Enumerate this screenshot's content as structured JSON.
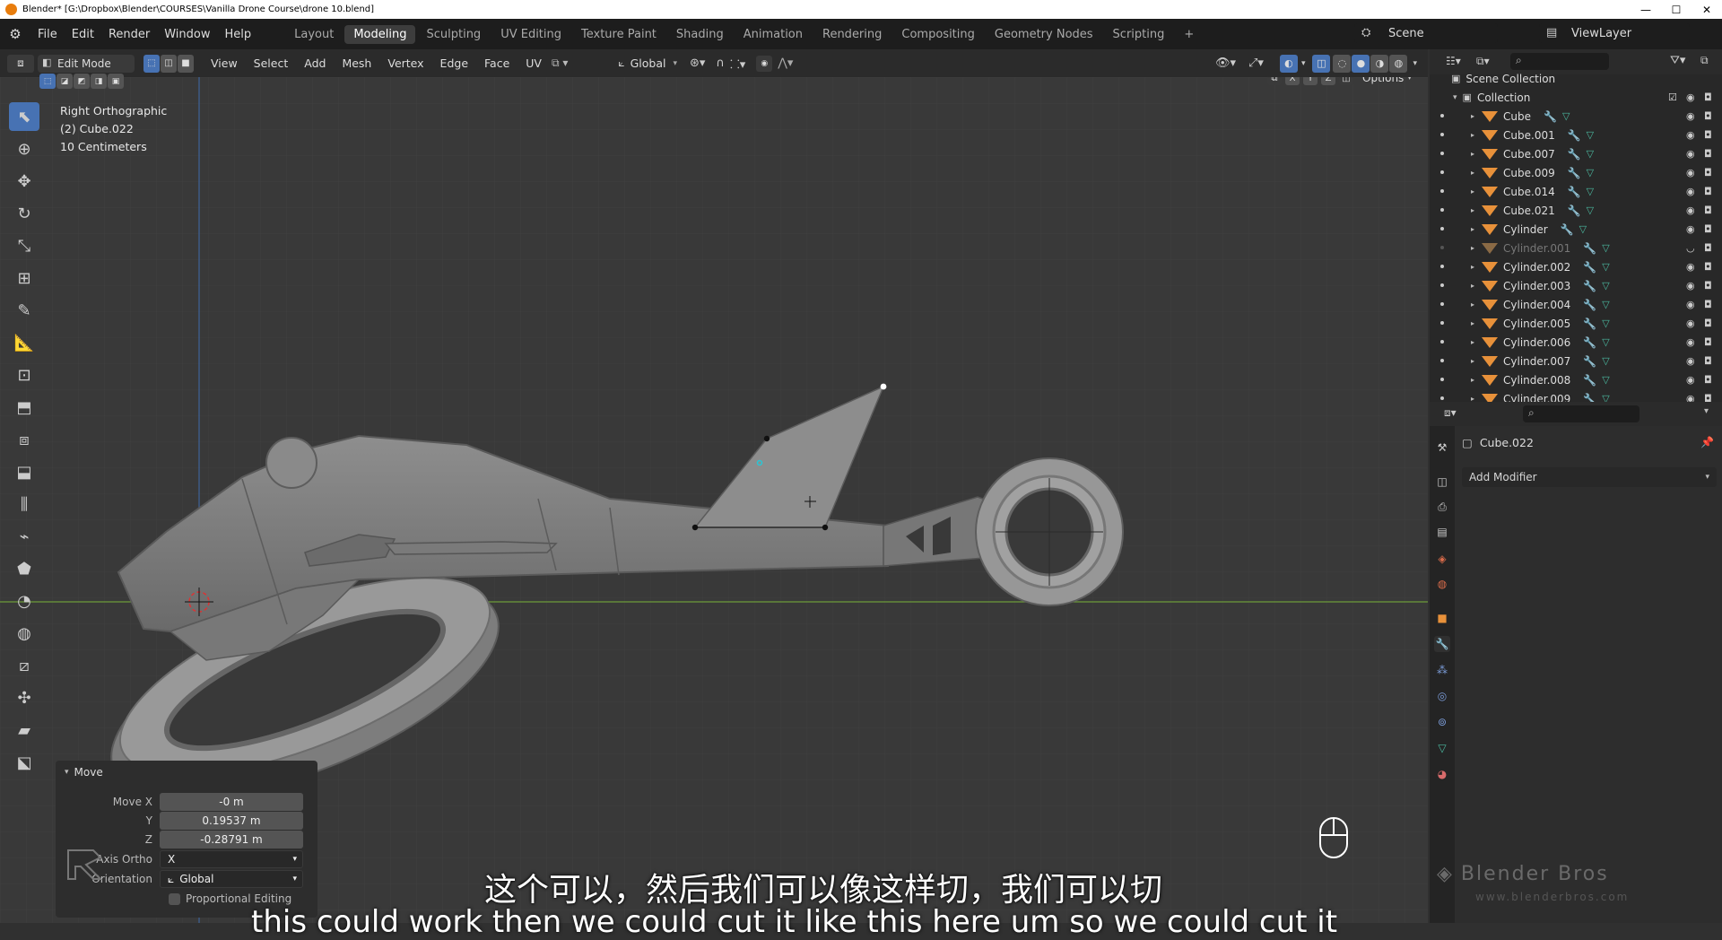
{
  "window": {
    "title": "Blender* [G:\\Dropbox\\Blender\\COURSES\\Vanilla Drone Course\\drone 10.blend]",
    "controls": [
      "—",
      "☐",
      "✕"
    ]
  },
  "topbar": {
    "menus": [
      "File",
      "Edit",
      "Render",
      "Window",
      "Help"
    ],
    "workspaces": [
      "Layout",
      "Modeling",
      "Sculpting",
      "UV Editing",
      "Texture Paint",
      "Shading",
      "Animation",
      "Rendering",
      "Compositing",
      "Geometry Nodes",
      "Scripting"
    ],
    "active_workspace": "Modeling",
    "add_workspace": "+",
    "scene": "Scene",
    "view_layer": "ViewLayer"
  },
  "viewport_header": {
    "mode": "Edit Mode",
    "menus": [
      "View",
      "Select",
      "Add",
      "Mesh",
      "Vertex",
      "Edge",
      "Face",
      "UV"
    ],
    "orientation": "Global",
    "options_label": "Options",
    "axes": [
      "X",
      "Y",
      "Z"
    ]
  },
  "viewport_info": {
    "view": "Right Orthographic",
    "object": "(2) Cube.022",
    "scale": "10 Centimeters"
  },
  "move_panel": {
    "title": "Move",
    "move_x_label": "Move X",
    "move_x": "-0 m",
    "y_label": "Y",
    "y": "0.19537 m",
    "z_label": "Z",
    "z": "-0.28791 m",
    "axis_ortho_label": "Axis Ortho",
    "axis_ortho": "X",
    "orientation_label": "Orientation",
    "orientation": "Global",
    "proportional_label": "Proportional Editing"
  },
  "outliner": {
    "scene_collection": "Scene Collection",
    "collection": "Collection",
    "items": [
      {
        "name": "Cube",
        "dim": false
      },
      {
        "name": "Cube.001",
        "dim": false
      },
      {
        "name": "Cube.007",
        "dim": false
      },
      {
        "name": "Cube.009",
        "dim": false
      },
      {
        "name": "Cube.014",
        "dim": false
      },
      {
        "name": "Cube.021",
        "dim": false
      },
      {
        "name": "Cylinder",
        "dim": false
      },
      {
        "name": "Cylinder.001",
        "dim": true
      },
      {
        "name": "Cylinder.002",
        "dim": false
      },
      {
        "name": "Cylinder.003",
        "dim": false
      },
      {
        "name": "Cylinder.004",
        "dim": false
      },
      {
        "name": "Cylinder.005",
        "dim": false
      },
      {
        "name": "Cylinder.006",
        "dim": false
      },
      {
        "name": "Cylinder.007",
        "dim": false
      },
      {
        "name": "Cylinder.008",
        "dim": false
      },
      {
        "name": "Cylinder.009",
        "dim": false
      }
    ]
  },
  "properties": {
    "object": "Cube.022",
    "add_modifier": "Add Modifier"
  },
  "subtitle": {
    "zh": "这个可以，然后我们可以像这样切，我们可以切",
    "en": "this could work then we could cut it like this here um so we could cut it"
  },
  "watermark": {
    "brand": "Blender Bros",
    "url": "www.blenderbros.com"
  },
  "colors": {
    "accent": "#4772b3",
    "object_orange": "#e8913a",
    "x_axis_green": "#6d9a3a",
    "y_axis_blue": "#3d5f92"
  }
}
